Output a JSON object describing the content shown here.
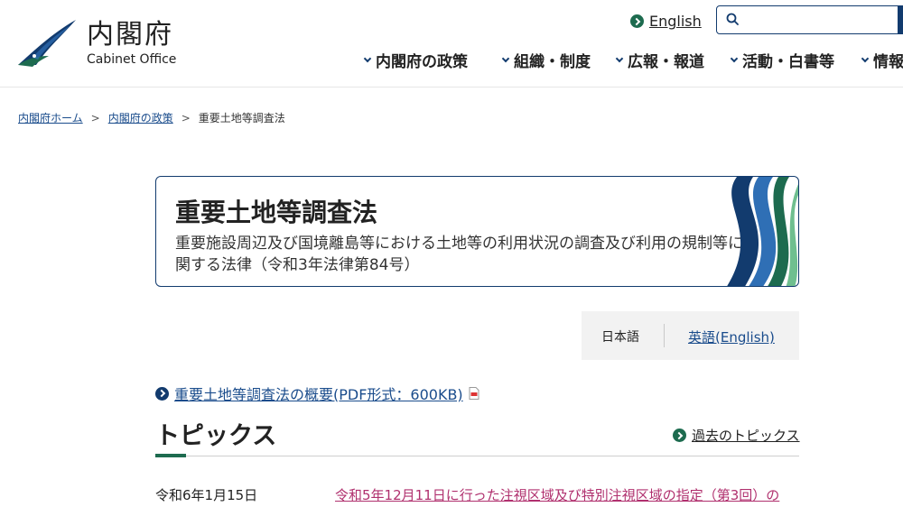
{
  "header": {
    "logo_ja": "内閣府",
    "logo_en": "Cabinet Office",
    "english_label": "English",
    "search_placeholder": "",
    "nav": [
      {
        "label": "内閣府の政策"
      },
      {
        "label": "組織・制度"
      },
      {
        "label": "広報・報道"
      },
      {
        "label": "活動・白書等"
      },
      {
        "label": "情報"
      }
    ]
  },
  "breadcrumb": {
    "items": [
      "内閣府ホーム",
      "内閣府の政策"
    ],
    "current": "重要土地等調査法",
    "separator": ">"
  },
  "title_card": {
    "title": "重要土地等調査法",
    "subtitle": "重要施設周辺及び国境離島等における土地等の利用状況の調査及び利用の規制等に関する法律（令和3年法律第84号）"
  },
  "language": {
    "japanese": "日本語",
    "english": "英語(English)"
  },
  "pdf_link": {
    "label": "重要土地等調査法の概要(PDF形式：600KB)"
  },
  "topics": {
    "heading": "トピックス",
    "past_link": "過去のトピックス",
    "items": [
      {
        "date": "令和6年1月15日",
        "title": "令和5年12月11日に行った注視区域及び特別注視区域の指定（第3回）の"
      }
    ]
  },
  "colors": {
    "navy": "#123b6e",
    "green": "#1d6b4f",
    "link": "#1a4c8c",
    "news_link": "#b0306e"
  }
}
